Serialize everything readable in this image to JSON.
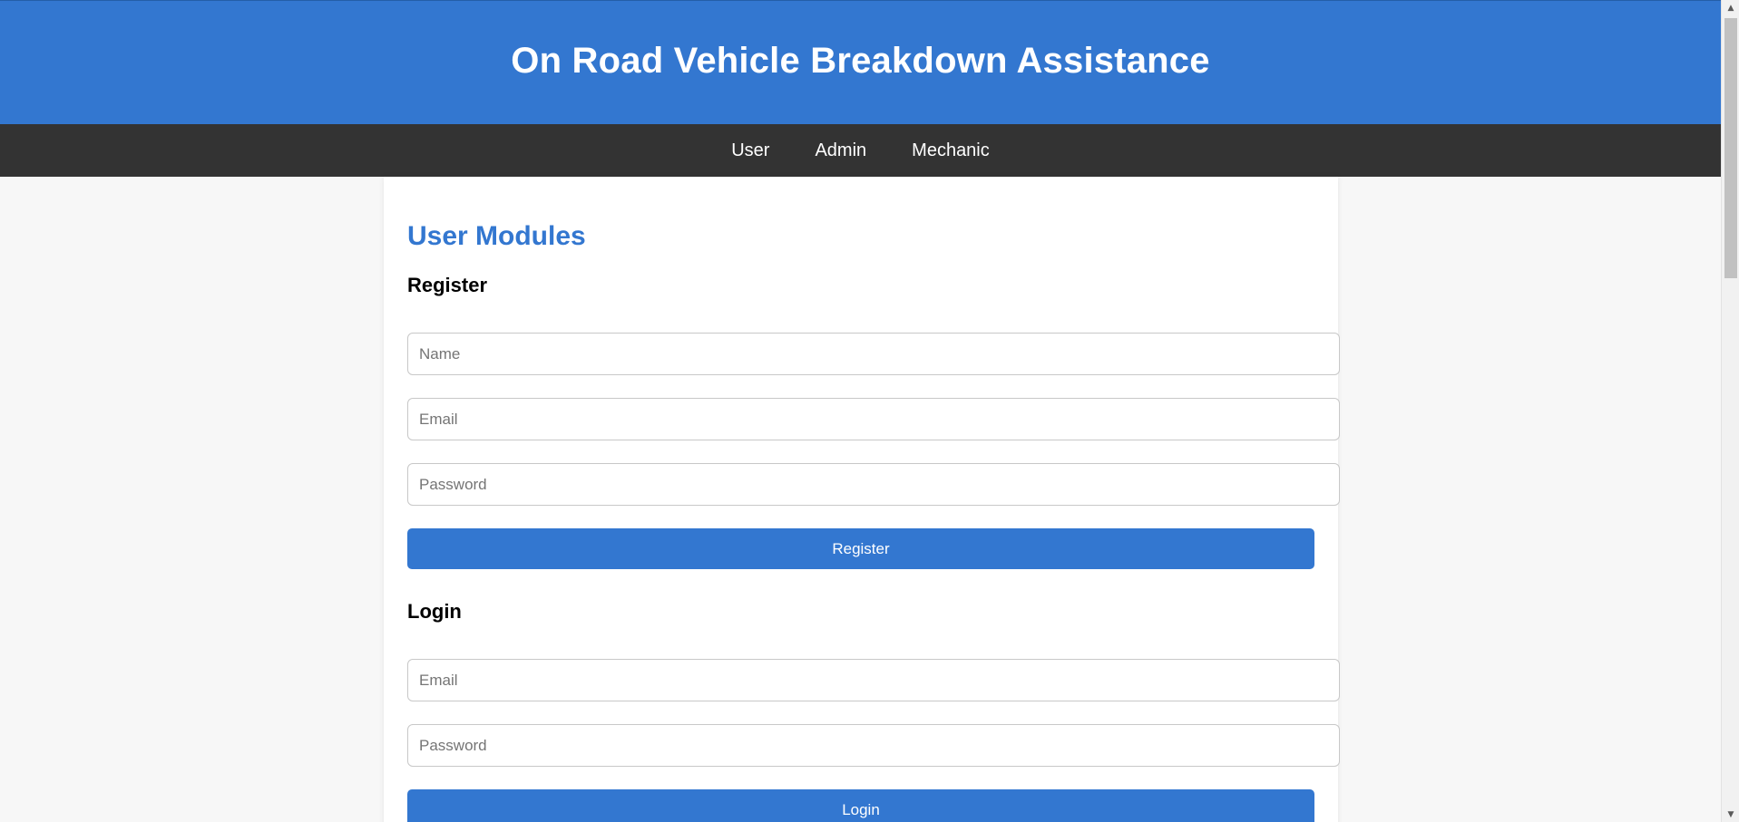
{
  "header": {
    "title": "On Road Vehicle Breakdown Assistance"
  },
  "nav": {
    "items": [
      "User",
      "Admin",
      "Mechanic"
    ]
  },
  "main": {
    "module_title": "User Modules",
    "register": {
      "heading": "Register",
      "name_placeholder": "Name",
      "email_placeholder": "Email",
      "password_placeholder": "Password",
      "button_label": "Register"
    },
    "login": {
      "heading": "Login",
      "email_placeholder": "Email",
      "password_placeholder": "Password",
      "button_label": "Login"
    }
  },
  "scrollbar": {
    "up_icon": "▲",
    "down_icon": "▼"
  },
  "colors": {
    "brand": "#3377d0",
    "nav_bg": "#333333",
    "page_bg": "#f7f7f7"
  }
}
